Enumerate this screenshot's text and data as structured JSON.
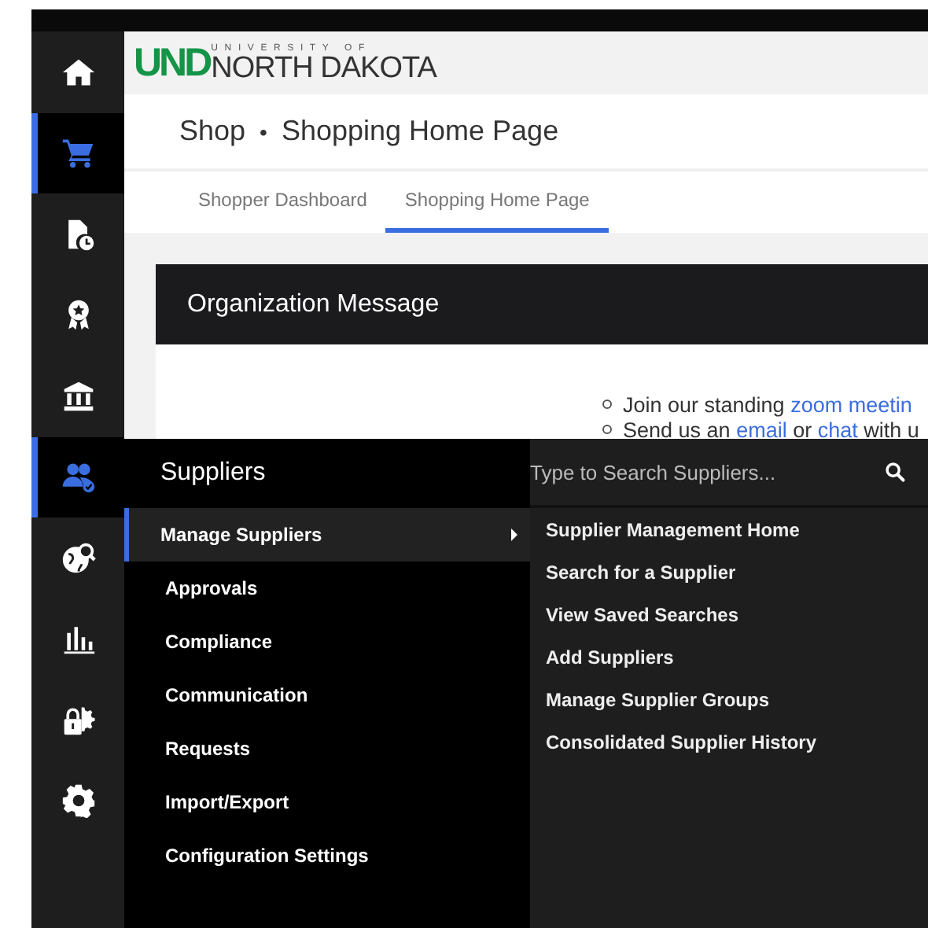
{
  "logo": {
    "mark": "UND",
    "upper": "UNIVERSITY OF",
    "name": "NORTH DAKOTA"
  },
  "sidebar": {
    "items": [
      {
        "selected": false
      },
      {
        "selected": true
      },
      {
        "selected": false
      },
      {
        "selected": false
      },
      {
        "selected": false
      },
      {
        "selected": true
      },
      {
        "selected": false
      },
      {
        "selected": false
      },
      {
        "selected": false
      },
      {
        "selected": false
      }
    ]
  },
  "breadcrumb": {
    "section": "Shop",
    "separator": "•",
    "page": "Shopping Home Page"
  },
  "tabs": [
    {
      "label": "Shopper Dashboard",
      "selected": false
    },
    {
      "label": "Shopping Home Page",
      "selected": true
    }
  ],
  "org_message": {
    "title": "Organization Message",
    "items": [
      [
        "Join our standing ",
        {
          "link": "zoom meetin"
        }
      ],
      [
        "Send us an ",
        {
          "link": "email"
        },
        " or ",
        {
          "link": "chat"
        },
        " with u"
      ]
    ]
  },
  "flyout": {
    "title": "Suppliers",
    "items": [
      {
        "label": "Manage Suppliers",
        "selected": true,
        "has_submenu": true
      },
      {
        "label": "Approvals",
        "selected": false,
        "has_submenu": false
      },
      {
        "label": "Compliance",
        "selected": false,
        "has_submenu": false
      },
      {
        "label": "Communication",
        "selected": false,
        "has_submenu": false
      },
      {
        "label": "Requests",
        "selected": false,
        "has_submenu": false
      },
      {
        "label": "Import/Export",
        "selected": false,
        "has_submenu": false
      },
      {
        "label": "Configuration Settings",
        "selected": false,
        "has_submenu": false
      }
    ],
    "search": {
      "placeholder": "Type to Search Suppliers..."
    },
    "submenu": [
      "Supplier Management Home",
      "Search for a Supplier",
      "View Saved Searches",
      "Add Suppliers",
      "Manage Supplier Groups",
      "Consolidated Supplier History"
    ]
  }
}
